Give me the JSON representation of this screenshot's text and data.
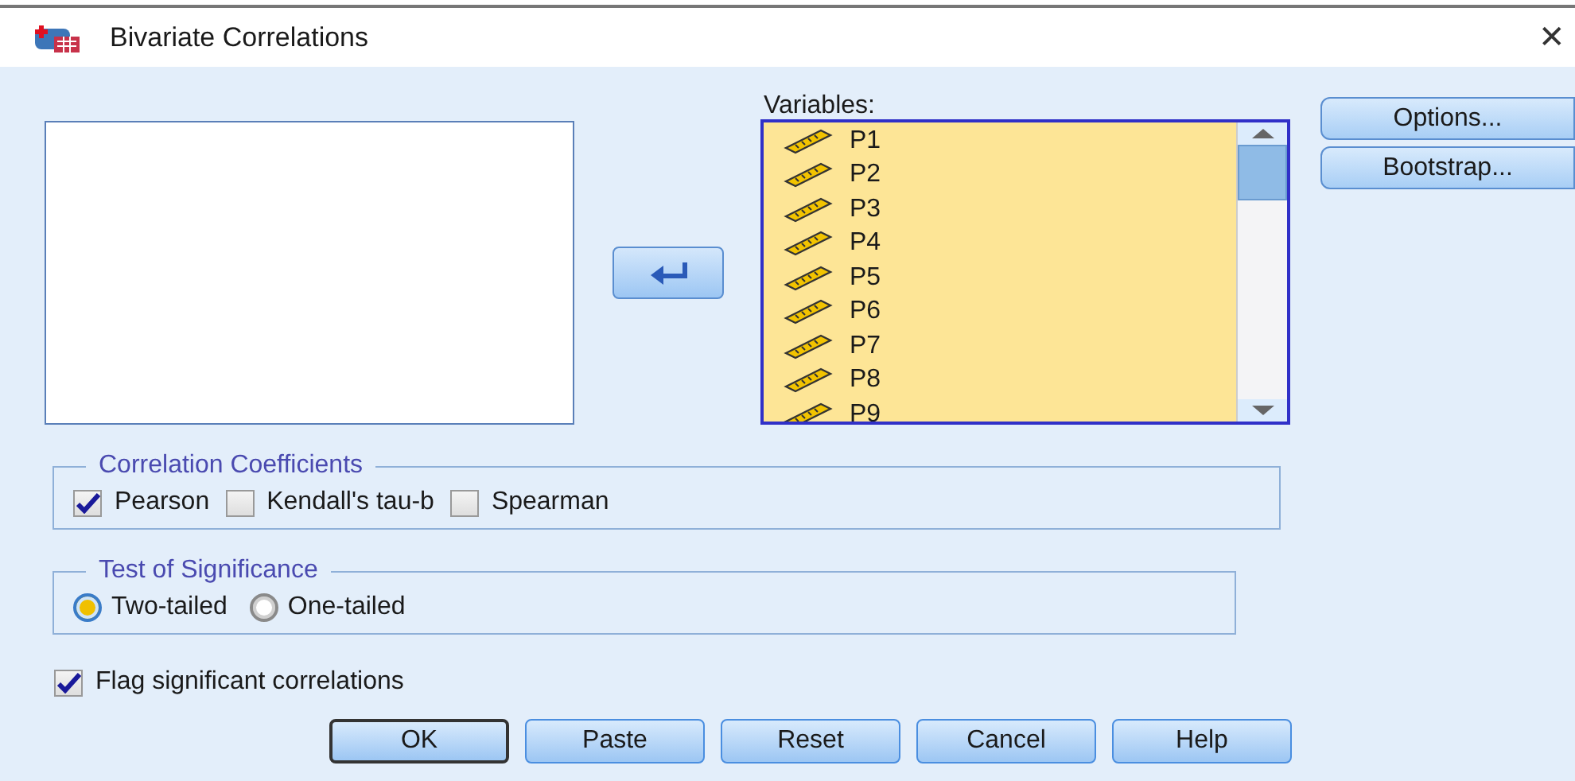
{
  "window": {
    "title": "Bivariate Correlations",
    "close": "✕"
  },
  "variables": {
    "label": "Variables:",
    "items": [
      "P1",
      "P2",
      "P3",
      "P4",
      "P5",
      "P6",
      "P7",
      "P8",
      "P9"
    ]
  },
  "side_buttons": [
    "Options...",
    "Bootstrap..."
  ],
  "correlation_coefficients": {
    "title": "Correlation Coefficients",
    "options": [
      {
        "label": "Pearson",
        "checked": true
      },
      {
        "label": "Kendall's tau-b",
        "checked": false
      },
      {
        "label": "Spearman",
        "checked": false
      }
    ]
  },
  "test_of_significance": {
    "title": "Test of Significance",
    "options": [
      {
        "label": "Two-tailed",
        "selected": true
      },
      {
        "label": "One-tailed",
        "selected": false
      }
    ]
  },
  "flag_significant": {
    "label": "Flag significant correlations",
    "checked": true
  },
  "buttons": [
    {
      "label": "OK",
      "default": true
    },
    {
      "label": "Paste",
      "default": false
    },
    {
      "label": "Reset",
      "default": false
    },
    {
      "label": "Cancel",
      "default": false
    },
    {
      "label": "Help",
      "default": false
    }
  ]
}
